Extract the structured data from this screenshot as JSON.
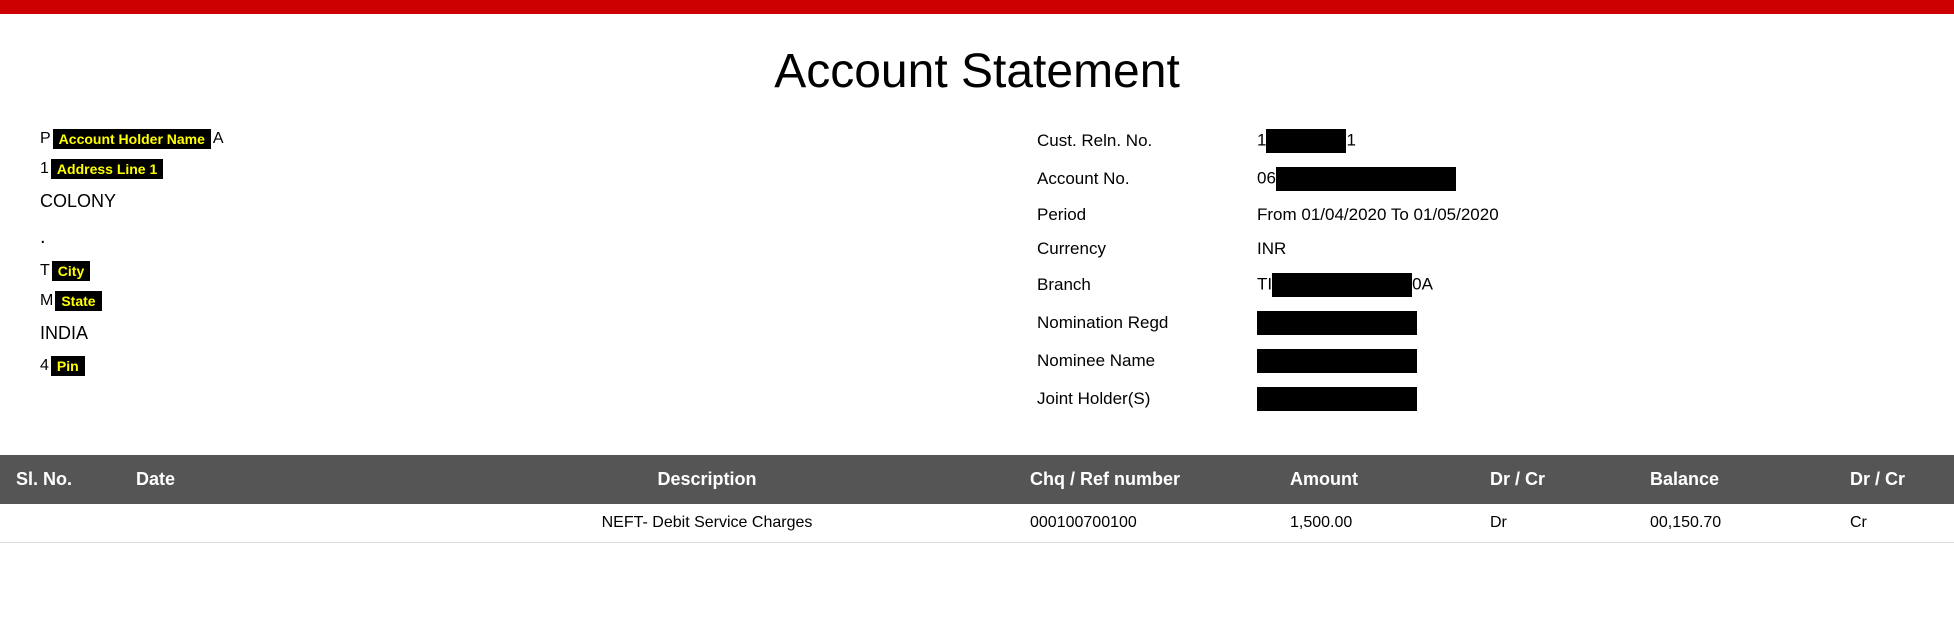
{
  "topBar": {
    "color": "#cc0000"
  },
  "header": {
    "title": "Account Statement"
  },
  "leftSection": {
    "accountHolderLabel": "Account Holder Name",
    "accountHolderPrefix": "P",
    "accountHolderSuffix": "A",
    "addressLine1Label": "Address Line 1",
    "addressLine1Prefix": "1",
    "colony": "COLONY",
    "dot": ".",
    "cityLabel": "City",
    "cityPrefix": "T",
    "stateLabel": "State",
    "statePrefix": "M",
    "country": "INDIA",
    "pinLabel": "Pin",
    "pinPrefix": "4"
  },
  "rightSection": {
    "fields": [
      {
        "label": "Cust. Reln. No.",
        "prefix": "1",
        "suffix": "1",
        "redactedWidth": 80
      },
      {
        "label": "Account No.",
        "prefix": "06",
        "suffix": "",
        "redactedWidth": 180
      },
      {
        "label": "Period",
        "value": "From 01/04/2020 To 01/05/2020"
      },
      {
        "label": "Currency",
        "value": "INR"
      },
      {
        "label": "Branch",
        "prefix": "TI",
        "suffix": "0A",
        "redactedWidth": 140
      },
      {
        "label": "Nomination Regd",
        "redactedWidth": 160
      },
      {
        "label": "Nominee Name",
        "redactedWidth": 160
      },
      {
        "label": "Joint Holder(S)",
        "redactedWidth": 160
      }
    ]
  },
  "table": {
    "headers": [
      {
        "id": "slno",
        "label": "Sl. No."
      },
      {
        "id": "date",
        "label": "Date"
      },
      {
        "id": "desc",
        "label": "Description"
      },
      {
        "id": "chq",
        "label": "Chq / Ref number"
      },
      {
        "id": "amount",
        "label": "Amount"
      },
      {
        "id": "drcr",
        "label": "Dr / Cr"
      },
      {
        "id": "balance",
        "label": "Balance"
      },
      {
        "id": "drcr2",
        "label": "Dr / Cr"
      }
    ],
    "rows": [
      {
        "slno": "",
        "date": "",
        "desc": "NEFT- Debit Service Charges",
        "chq": "000100700100",
        "amount": "1,500.00",
        "drcr": "Dr",
        "balance": "00,150.70",
        "drcr2": "Cr"
      }
    ]
  }
}
